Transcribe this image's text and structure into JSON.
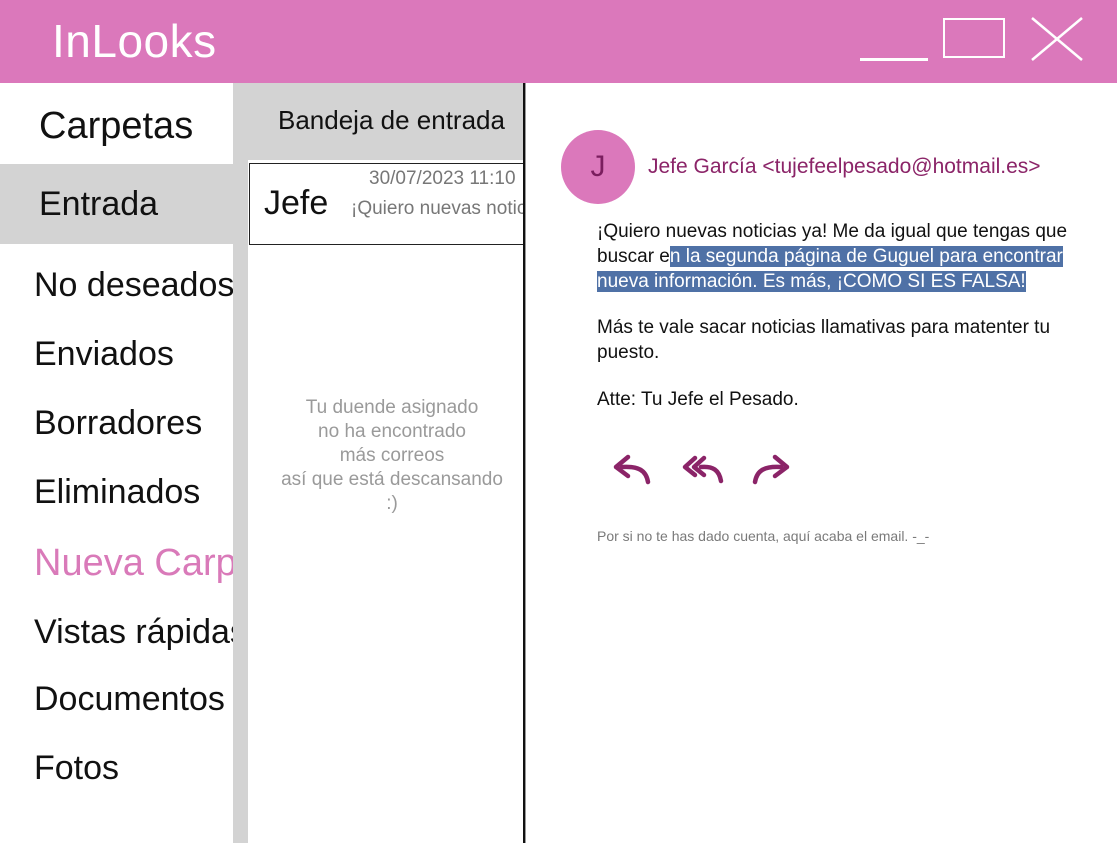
{
  "app": {
    "title": "InLooks"
  },
  "window_controls": [
    "minimize-icon",
    "maximize-icon",
    "close-icon"
  ],
  "colors": {
    "titlebar": "#db78bb",
    "accent": "#d97ab9",
    "selection": "#4f71a6",
    "sender": "#8b2468",
    "panel_gray": "#d3d3d3"
  },
  "sidebar": {
    "heading": "Carpetas",
    "folders": [
      {
        "label": "Entrada",
        "selected": true
      },
      {
        "label": "No deseados"
      },
      {
        "label": "Enviados"
      },
      {
        "label": "Borradores"
      },
      {
        "label": "Eliminados"
      },
      {
        "label": "Nueva Carpeta"
      },
      {
        "label": "Vistas rápidas"
      },
      {
        "label": "Documentos"
      },
      {
        "label": "Fotos"
      }
    ]
  },
  "inbox": {
    "header": "Bandeja de entrada",
    "messages": [
      {
        "sender": "Jefe",
        "date": "30/07/2023 11:10",
        "preview": "¡Quiero nuevas noticias ya!"
      }
    ],
    "empty_lines": [
      "Tu duende asignado",
      "no ha encontrado",
      "más correos",
      "así que está descansando",
      ":)"
    ]
  },
  "reading": {
    "avatar_initial": "J",
    "sender": "Jefe García <tujefeelpesado@hotmail.es>",
    "p1_line1": "¡Quiero nuevas noticias ya! Me da igual que tengas que",
    "p1_line2_plain": "buscar e",
    "p1_line2_selected": "n la segunda página de Guguel para encontrar",
    "p1_line3_selected": "nueva información. Es más, ¡COMO SI ES FALSA! ",
    "p2": "Más te vale sacar noticias llamativas para matenter tu puesto.",
    "p3": "Atte: Tu Jefe el Pesado.",
    "actions": [
      "reply-icon",
      "reply-all-icon",
      "forward-icon"
    ],
    "footer": "Por si no te has dado cuenta, aquí acaba el email. -_-"
  }
}
